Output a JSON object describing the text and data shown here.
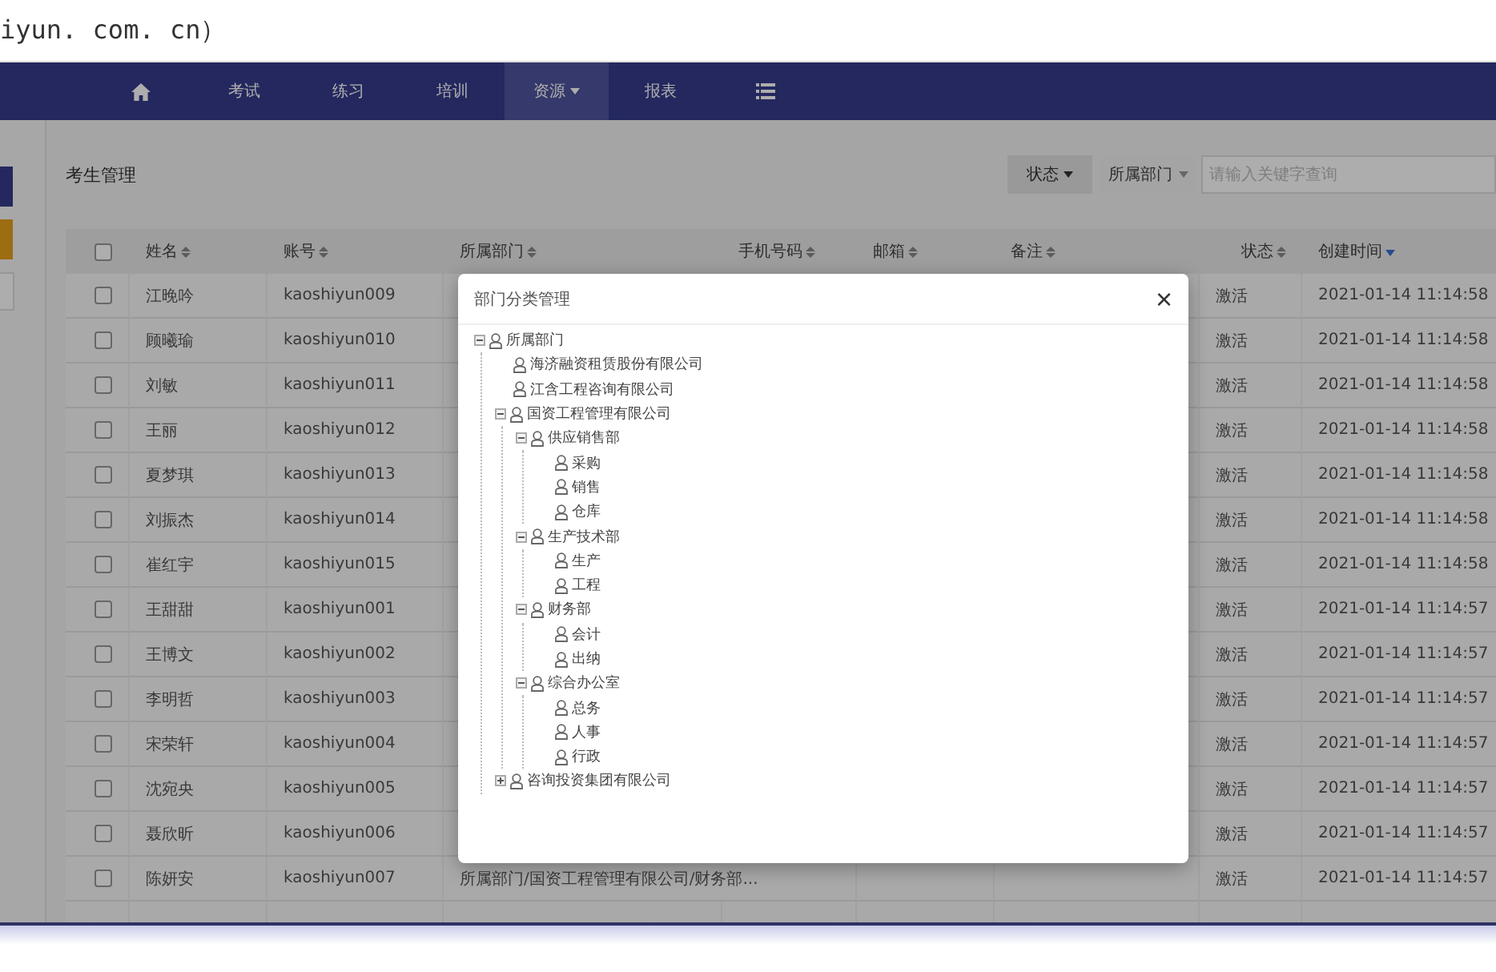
{
  "address_fragment": "iyun. com. cn）",
  "nav": {
    "items": [
      {
        "label": "考试",
        "selected": false,
        "dropdown": false
      },
      {
        "label": "练习",
        "selected": false,
        "dropdown": false
      },
      {
        "label": "培训",
        "selected": false,
        "dropdown": false
      },
      {
        "label": "资源",
        "selected": true,
        "dropdown": true
      },
      {
        "label": "报表",
        "selected": false,
        "dropdown": false
      }
    ]
  },
  "page_title": "考生管理",
  "filters": {
    "status_button": "状态",
    "department_select": "所属部门",
    "search": {
      "placeholder": "请输入关键字查询"
    }
  },
  "table": {
    "select_all": {
      "checked": false
    },
    "columns": [
      {
        "label": "姓名",
        "sorted": false
      },
      {
        "label": "账号",
        "sorted": false
      },
      {
        "label": "所属部门",
        "sorted": false
      },
      {
        "label": "手机号码",
        "sorted": false
      },
      {
        "label": "邮箱",
        "sorted": false
      },
      {
        "label": "备注",
        "sorted": false
      },
      {
        "label": "状态",
        "sorted": false
      },
      {
        "label": "创建时间",
        "sorted": true
      }
    ],
    "rows": [
      {
        "checked": false,
        "name": "江晚吟",
        "account": "kaoshiyun009",
        "status": "激活",
        "created": "2021-01-14 11:14:58"
      },
      {
        "checked": false,
        "name": "顾曦瑜",
        "account": "kaoshiyun010",
        "status": "激活",
        "created": "2021-01-14 11:14:58"
      },
      {
        "checked": false,
        "name": "刘敏",
        "account": "kaoshiyun011",
        "status": "激活",
        "created": "2021-01-14 11:14:58"
      },
      {
        "checked": false,
        "name": "王丽",
        "account": "kaoshiyun012",
        "status": "激活",
        "created": "2021-01-14 11:14:58"
      },
      {
        "checked": false,
        "name": "夏梦琪",
        "account": "kaoshiyun013",
        "status": "激活",
        "created": "2021-01-14 11:14:58"
      },
      {
        "checked": false,
        "name": "刘振杰",
        "account": "kaoshiyun014",
        "status": "激活",
        "created": "2021-01-14 11:14:58"
      },
      {
        "checked": false,
        "name": "崔红宇",
        "account": "kaoshiyun015",
        "status": "激活",
        "created": "2021-01-14 11:14:58"
      },
      {
        "checked": false,
        "name": "王甜甜",
        "account": "kaoshiyun001",
        "status": "激活",
        "created": "2021-01-14 11:14:57"
      },
      {
        "checked": false,
        "name": "王博文",
        "account": "kaoshiyun002",
        "status": "激活",
        "created": "2021-01-14 11:14:57"
      },
      {
        "checked": false,
        "name": "李明哲",
        "account": "kaoshiyun003",
        "status": "激活",
        "created": "2021-01-14 11:14:57"
      },
      {
        "checked": false,
        "name": "宋荣轩",
        "account": "kaoshiyun004",
        "status": "激活",
        "created": "2021-01-14 11:14:57"
      },
      {
        "checked": false,
        "name": "沈宛央",
        "account": "kaoshiyun005",
        "status": "激活",
        "created": "2021-01-14 11:14:57"
      },
      {
        "checked": false,
        "name": "聂欣昕",
        "account": "kaoshiyun006",
        "status": "激活",
        "created": "2021-01-14 11:14:57"
      },
      {
        "checked": false,
        "name": "陈妍安",
        "account": "kaoshiyun007",
        "department": "所属部门/国资工程管理有限公司/财务部...",
        "status": "激活",
        "created": "2021-01-14 11:14:57"
      }
    ]
  },
  "dialog": {
    "title": "部门分类管理",
    "close": "×",
    "tree": [
      {
        "label": "所属部门",
        "expanded": true,
        "children": [
          {
            "label": "海济融资租赁股份有限公司"
          },
          {
            "label": "江含工程咨询有限公司"
          },
          {
            "label": "国资工程管理有限公司",
            "expanded": true,
            "children": [
              {
                "label": "供应销售部",
                "expanded": true,
                "children": [
                  {
                    "label": "采购"
                  },
                  {
                    "label": "销售"
                  },
                  {
                    "label": "仓库"
                  }
                ]
              },
              {
                "label": "生产技术部",
                "expanded": true,
                "children": [
                  {
                    "label": "生产"
                  },
                  {
                    "label": "工程"
                  }
                ]
              },
              {
                "label": "财务部",
                "expanded": true,
                "children": [
                  {
                    "label": "会计"
                  },
                  {
                    "label": "出纳"
                  }
                ]
              },
              {
                "label": "综合办公室",
                "expanded": true,
                "children": [
                  {
                    "label": "总务"
                  },
                  {
                    "label": "人事"
                  },
                  {
                    "label": "行政"
                  }
                ]
              }
            ]
          },
          {
            "label": "咨询投资集团有限公司",
            "expanded": false
          }
        ]
      }
    ]
  }
}
